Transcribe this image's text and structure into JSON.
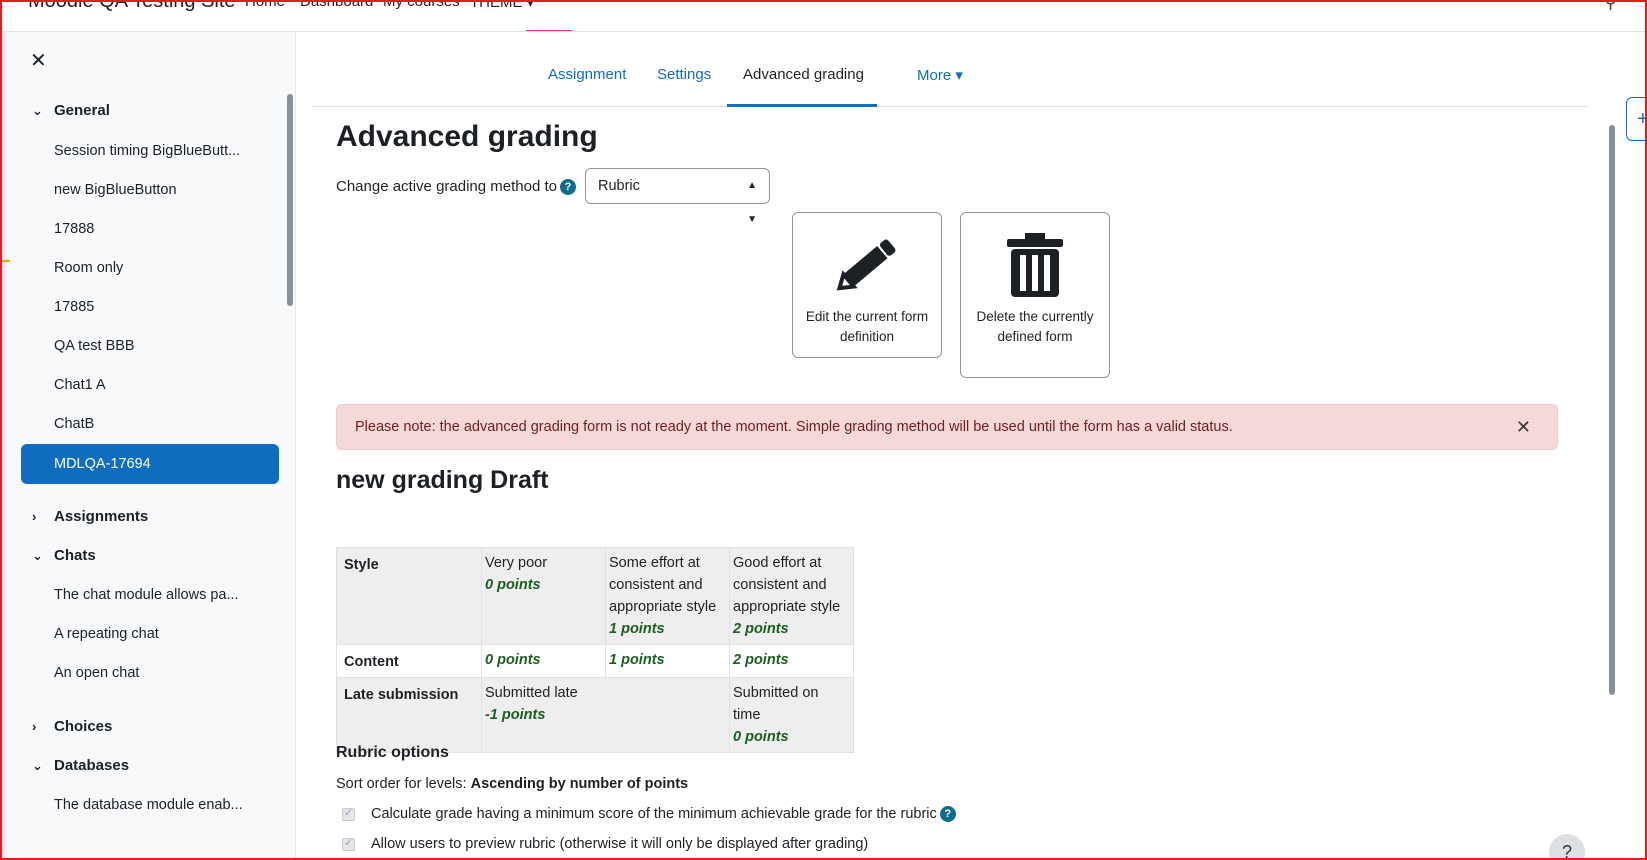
{
  "navbar": {
    "site_name": "Moodle QA Testing Site",
    "items": [
      "Home",
      "Dashboard",
      "My courses",
      "THEME ▾"
    ]
  },
  "drawer": {
    "close_label": "✕",
    "sections": [
      {
        "label": "General",
        "expanded": true
      },
      {
        "label": "Assignments",
        "expanded": false
      },
      {
        "label": "Chats",
        "expanded": true
      },
      {
        "label": "Choices",
        "expanded": false
      },
      {
        "label": "Databases",
        "expanded": true
      }
    ],
    "general_items": [
      "Session timing BigBlueButt...",
      "new BigBlueButton",
      "17888",
      "Room only",
      "17885",
      "QA test BBB",
      "Chat1 A",
      "ChatB",
      "MDLQA-17694"
    ],
    "chat_items": [
      "The chat module allows pa...",
      "A repeating chat",
      "An open chat"
    ],
    "database_items": [
      "The database module enab..."
    ]
  },
  "tabs": [
    {
      "label": "Assignment",
      "active": false
    },
    {
      "label": "Settings",
      "active": false
    },
    {
      "label": "Advanced grading",
      "active": true
    },
    {
      "label": "More ▾",
      "active": false
    }
  ],
  "page": {
    "title": "Advanced grading",
    "method_label": "Change active grading method to",
    "method_value": "Rubric",
    "edit_button": "Edit the current form definition",
    "delete_button": "Delete the currently defined form",
    "alert": "Please note: the advanced grading form is not ready at the moment. Simple grading method will be used until the form has a valid status.",
    "form_title": "new grading Draft"
  },
  "rubric": {
    "criteria": [
      {
        "name": "Style",
        "levels": [
          {
            "definition": "Very poor",
            "points": "0 points"
          },
          {
            "definition": "Some effort at consistent and appropriate style",
            "points": "1 points"
          },
          {
            "definition": "Good effort at consistent and appropriate style",
            "points": "2 points"
          }
        ]
      },
      {
        "name": "Content",
        "levels": [
          {
            "definition": "",
            "points": "0 points"
          },
          {
            "definition": "",
            "points": "1 points"
          },
          {
            "definition": "",
            "points": "2 points"
          }
        ]
      },
      {
        "name": "Late submission",
        "levels": [
          {
            "definition": "Submitted late",
            "points": "-1 points"
          },
          {
            "definition": "Submitted on time",
            "points": "0 points"
          }
        ]
      }
    ]
  },
  "options": {
    "title": "Rubric options",
    "sort_label": "Sort order for levels:",
    "sort_value": "Ascending by number of points",
    "check1": "Calculate grade having a minimum score of the minimum achievable grade for the rubric",
    "check2": "Allow users to preview rubric (otherwise it will only be displayed after grading)"
  },
  "help_fab": "?"
}
